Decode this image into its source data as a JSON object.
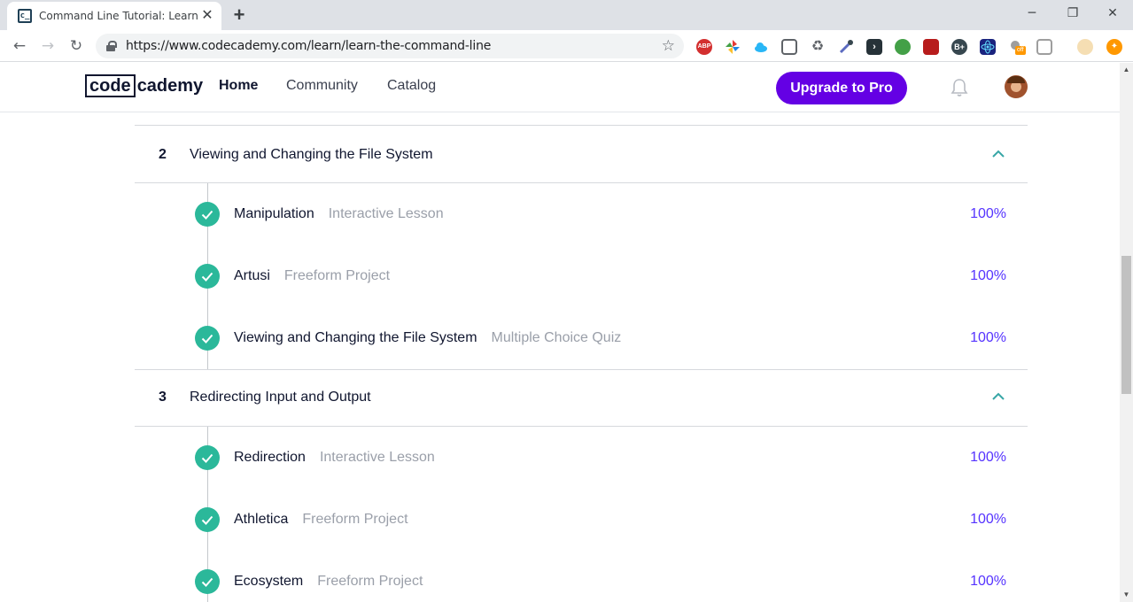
{
  "browser": {
    "tab_title": "Command Line Tutorial: Learn Th",
    "tab_favicon": "c_",
    "url": "https://www.codecademy.com/learn/learn-the-command-line",
    "extension_abp_label": "ABP",
    "extension_badge": "off"
  },
  "header": {
    "logo_box": "code",
    "logo_rest": "cademy",
    "nav": [
      "Home",
      "Community",
      "Catalog"
    ],
    "upgrade_label": "Upgrade to Pro"
  },
  "colors": {
    "accent": "#6400e4",
    "check": "#2bb89a",
    "percent": "#5533ff",
    "chevron": "#37a6a6"
  },
  "modules": [
    {
      "number": "2",
      "title": "Viewing and Changing the File System",
      "lessons": [
        {
          "title": "Manipulation",
          "type": "Interactive Lesson",
          "progress": "100%"
        },
        {
          "title": "Artusi",
          "type": "Freeform Project",
          "progress": "100%"
        },
        {
          "title": "Viewing and Changing the File System",
          "type": "Multiple Choice Quiz",
          "progress": "100%"
        }
      ]
    },
    {
      "number": "3",
      "title": "Redirecting Input and Output",
      "lessons": [
        {
          "title": "Redirection",
          "type": "Interactive Lesson",
          "progress": "100%"
        },
        {
          "title": "Athletica",
          "type": "Freeform Project",
          "progress": "100%"
        },
        {
          "title": "Ecosystem",
          "type": "Freeform Project",
          "progress": "100%"
        }
      ]
    }
  ]
}
